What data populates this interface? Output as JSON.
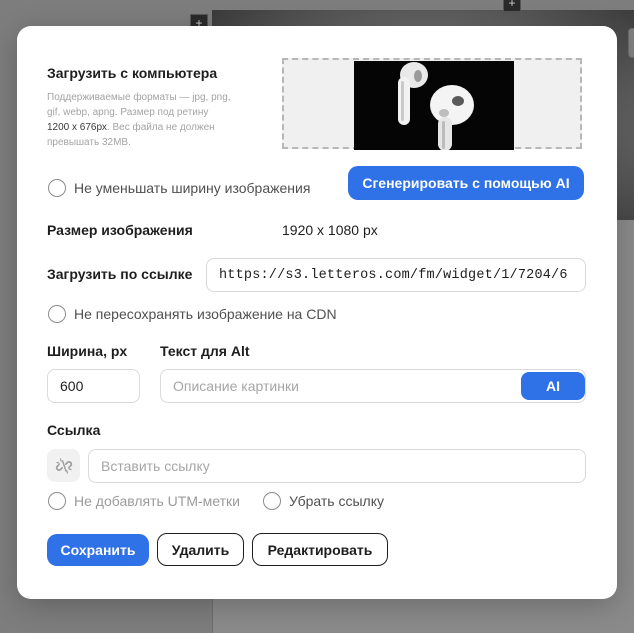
{
  "upload": {
    "title": "Загрузить с компьютера",
    "hint_line1": "Поддерживаемые форматы — jpg, png,",
    "hint_line2": "gif, webp, apng. Размер под ретину",
    "hint_size": "1200 х 676рх",
    "hint_line3": ". Вес файла не должен",
    "hint_line4": "превышать 32МВ."
  },
  "options": {
    "no_shrink_label": "Не уменьшать ширину изображения",
    "generate_ai_label": "Сгенерировать с помощью AI"
  },
  "image_size": {
    "label": "Размер изображения",
    "value": "1920 x 1080 px"
  },
  "url_upload": {
    "label": "Загрузить по ссылке",
    "value": "https://s3.letteros.com/fm/widget/1/7204/6",
    "no_resave_label": "Не пересохранять изображение на CDN"
  },
  "width": {
    "label": "Ширина, px",
    "value": "600"
  },
  "alt": {
    "label": "Текст для Alt",
    "placeholder": "Описание картинки",
    "ai_label": "AI"
  },
  "link": {
    "label": "Ссылка",
    "placeholder": "Вставить ссылку",
    "no_utm_label": "Не добавлять UTM-метки",
    "remove_link_label": "Убрать ссылку"
  },
  "actions": {
    "save": "Сохранить",
    "delete": "Удалить",
    "edit": "Редактировать"
  },
  "colors": {
    "accent": "#2f71e6",
    "overlay": "#7a7a7a"
  },
  "background": {
    "plus_glyph": "+"
  }
}
